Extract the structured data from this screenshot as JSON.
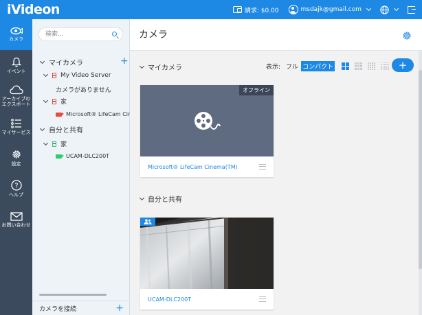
{
  "app": {
    "logo": "iVideon"
  },
  "topbar": {
    "billing_label": "請求: $0.00",
    "account_email": "msdajk@gmail.com"
  },
  "rail": {
    "items": [
      {
        "label": "カメラ",
        "icon": "camera-icon",
        "active": true
      },
      {
        "label": "イベント",
        "icon": "bell-icon"
      },
      {
        "label": "アーカイブの\nエクスポート",
        "icon": "cloud-icon"
      },
      {
        "label": "マイサービス",
        "icon": "list-icon"
      },
      {
        "label": "設定",
        "icon": "gear-icon"
      },
      {
        "label": "ヘルプ",
        "icon": "help-icon"
      },
      {
        "label": "お問い合わせ",
        "icon": "mail-icon"
      }
    ]
  },
  "tree": {
    "search_placeholder": "検索...",
    "my_cameras": "マイカメラ",
    "server_name": "My Video Server",
    "no_cameras": "カメラがありません",
    "home_folder": "家",
    "my_camera_item": "Microsoft® LifeCam Cinema(",
    "shared": "自分と共有",
    "shared_folder": "家",
    "shared_camera_item": "UCAM-DLC200T",
    "connect_camera": "カメラを接続"
  },
  "main": {
    "title": "カメラ",
    "my_cameras_section": "マイカメラ",
    "view_label": "表示:",
    "view_full": "フル",
    "view_compact": "コンパクト",
    "shared_section": "自分と共有",
    "cards": [
      {
        "name": "Microsoft® LifeCam Cinema(TM)",
        "status": "オフライン"
      },
      {
        "name": "UCAM-DLC200T"
      }
    ]
  },
  "colors": {
    "accent": "#1e88e5",
    "rail": "#3b4a5c",
    "offline_thumb": "#5f6b80",
    "recording_red": "#e74c3c",
    "online_green": "#2ecc71"
  }
}
